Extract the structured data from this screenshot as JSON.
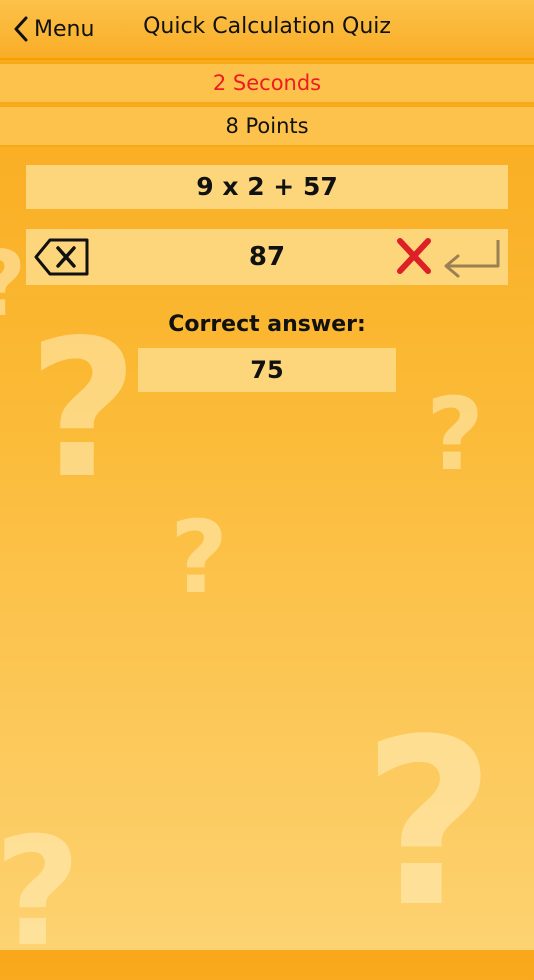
{
  "nav": {
    "back_label": "Menu",
    "title": "Quick Calculation Quiz"
  },
  "status": {
    "timer": "2 Seconds",
    "points": "8 Points"
  },
  "question": {
    "expression": "9 x 2 + 57"
  },
  "answer": {
    "entered": "87",
    "result_icon": "wrong-x-icon"
  },
  "correct": {
    "label": "Correct answer:",
    "value": "75"
  },
  "colors": {
    "timer_text": "#ec1c24",
    "wrong_mark": "#dd1f26",
    "enter_key": "#9a8052"
  },
  "decorations": {
    "glyph": "?"
  }
}
